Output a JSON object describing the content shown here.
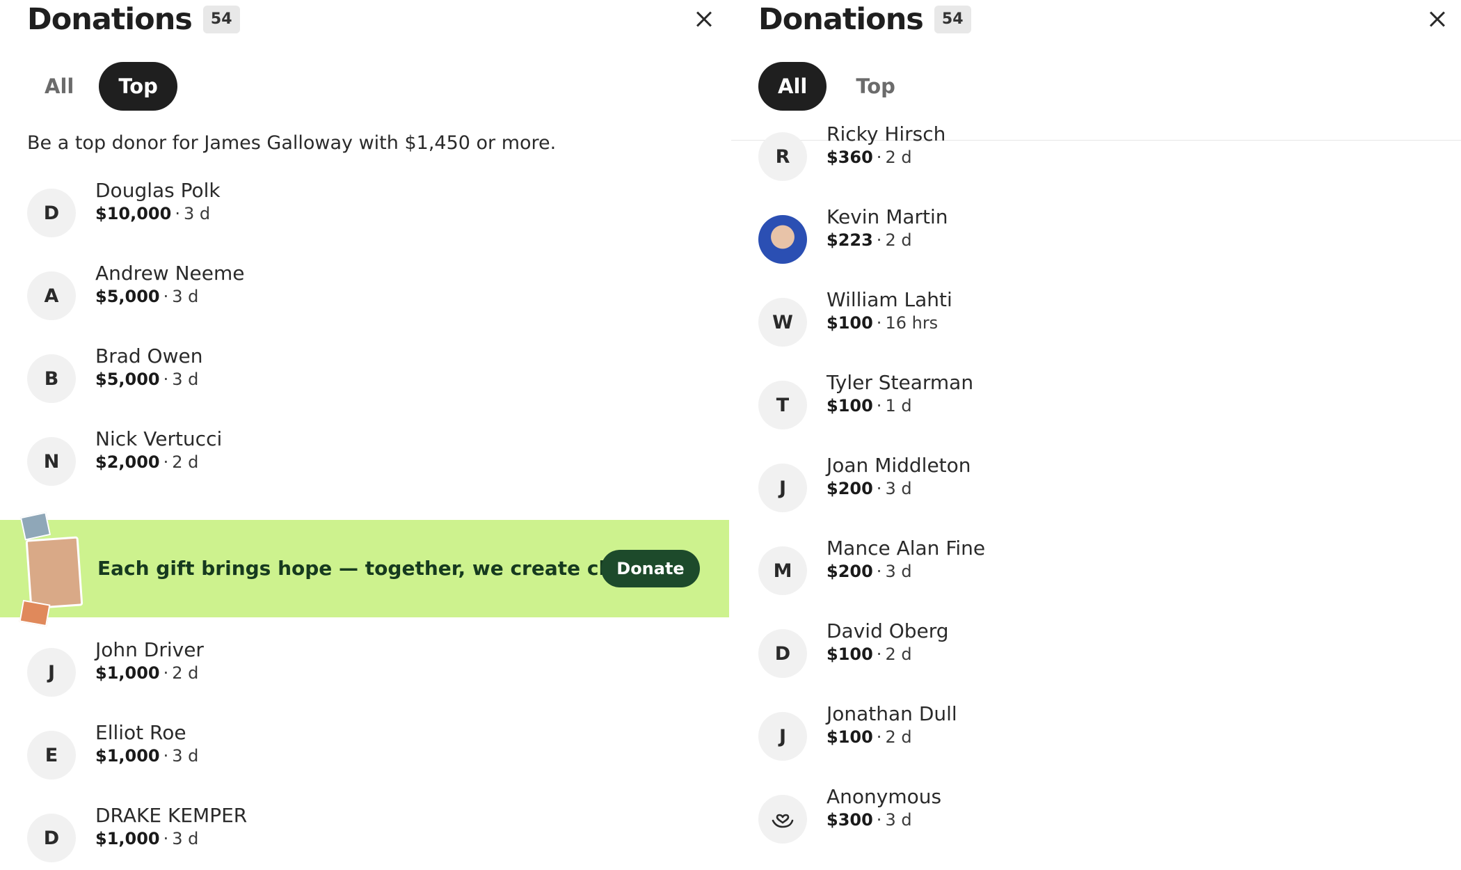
{
  "left": {
    "title": "Donations",
    "count": "54",
    "tabs": [
      {
        "label": "All"
      },
      {
        "label": "Top"
      }
    ],
    "active_tab": "Top",
    "subtitle": "Be a top donor for James Galloway with $1,450 or more.",
    "donors_top": [
      {
        "initial": "D",
        "name": "Douglas Polk",
        "amount": "$10,000",
        "time": "3 d"
      },
      {
        "initial": "A",
        "name": "Andrew Neeme",
        "amount": "$5,000",
        "time": "3 d"
      },
      {
        "initial": "B",
        "name": "Brad Owen",
        "amount": "$5,000",
        "time": "3 d"
      },
      {
        "initial": "N",
        "name": "Nick Vertucci",
        "amount": "$2,000",
        "time": "2 d"
      }
    ],
    "banner": {
      "text": "Each gift brings hope — together, we create change.",
      "button": "Donate"
    },
    "donors_bottom": [
      {
        "initial": "J",
        "name": "John Driver",
        "amount": "$1,000",
        "time": "2 d"
      },
      {
        "initial": "E",
        "name": "Elliot Roe",
        "amount": "$1,000",
        "time": "3 d"
      },
      {
        "initial": "D",
        "name": "DRAKE KEMPER",
        "amount": "$1,000",
        "time": "3 d"
      }
    ]
  },
  "right": {
    "title": "Donations",
    "count": "54",
    "tabs": [
      {
        "label": "All"
      },
      {
        "label": "Top"
      }
    ],
    "active_tab": "All",
    "donors": [
      {
        "initial": "R",
        "name": "Ricky Hirsch",
        "amount": "$360",
        "time": "2 d"
      },
      {
        "initial": "",
        "name": "Kevin Martin",
        "amount": "$223",
        "time": "2 d",
        "avatar": "photo"
      },
      {
        "initial": "W",
        "name": "William Lahti",
        "amount": "$100",
        "time": "16 hrs"
      },
      {
        "initial": "T",
        "name": "Tyler Stearman",
        "amount": "$100",
        "time": "1 d"
      },
      {
        "initial": "J",
        "name": "Joan Middleton",
        "amount": "$200",
        "time": "3 d"
      },
      {
        "initial": "M",
        "name": "Mance Alan Fine",
        "amount": "$200",
        "time": "3 d"
      },
      {
        "initial": "D",
        "name": "David Oberg",
        "amount": "$100",
        "time": "2 d"
      },
      {
        "initial": "J",
        "name": "Jonathan Dull",
        "amount": "$100",
        "time": "2 d"
      },
      {
        "initial": "",
        "name": "Anonymous",
        "amount": "$300",
        "time": "3 d",
        "avatar": "heart-hand-icon"
      }
    ]
  },
  "separator": "·",
  "colors": {
    "banner_bg": "#cdf28e",
    "donate_button": "#1d4a2b",
    "active_tab": "#1f1f1f",
    "avatar_bg": "#f1f1f1"
  }
}
